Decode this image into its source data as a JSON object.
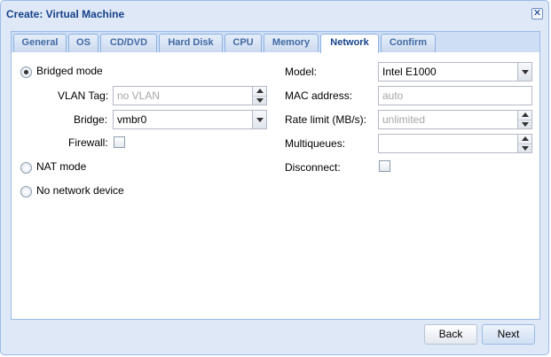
{
  "window": {
    "title": "Create: Virtual Machine",
    "close_symbol": "✕"
  },
  "tabs": [
    {
      "label": "General"
    },
    {
      "label": "OS"
    },
    {
      "label": "CD/DVD"
    },
    {
      "label": "Hard Disk"
    },
    {
      "label": "CPU"
    },
    {
      "label": "Memory"
    },
    {
      "label": "Network",
      "active": true
    },
    {
      "label": "Confirm"
    }
  ],
  "form": {
    "bridged_mode": {
      "label": "Bridged mode",
      "checked": true
    },
    "vlan_tag": {
      "label": "VLAN Tag:",
      "placeholder": "no VLAN",
      "value": ""
    },
    "bridge": {
      "label": "Bridge:",
      "value": "vmbr0"
    },
    "firewall": {
      "label": "Firewall:",
      "checked": false
    },
    "nat_mode": {
      "label": "NAT mode",
      "checked": false
    },
    "no_network": {
      "label": "No network device",
      "checked": false
    },
    "model": {
      "label": "Model:",
      "value": "Intel E1000"
    },
    "mac_address": {
      "label": "MAC address:",
      "placeholder": "auto",
      "value": ""
    },
    "rate_limit": {
      "label": "Rate limit (MB/s):",
      "placeholder": "unlimited",
      "value": ""
    },
    "multiqueues": {
      "label": "Multiqueues:",
      "value": ""
    },
    "disconnect": {
      "label": "Disconnect:",
      "checked": false
    }
  },
  "footer": {
    "back_label": "Back",
    "next_label": "Next"
  },
  "icons": {
    "close": "close-icon",
    "dropdown": "chevron-down-icon",
    "spinner": "spinner-arrows-icon"
  },
  "colors": {
    "title_text": "#15428b",
    "window_bg": "#dfe8f6",
    "border": "#99bbe8",
    "placeholder_text": "#a6a6a6"
  }
}
